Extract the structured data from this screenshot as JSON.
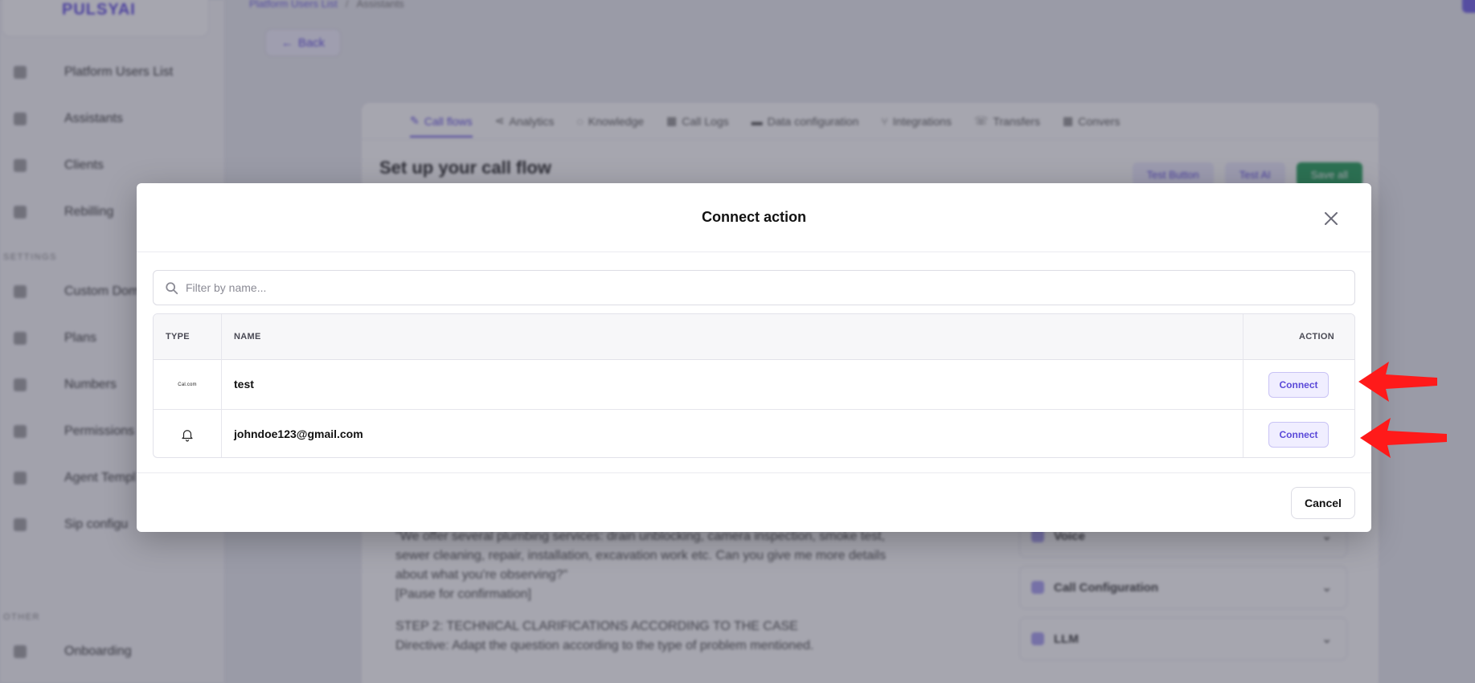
{
  "app": {
    "logo_text": "PULSYAI",
    "breadcrumb": {
      "parent": "Platform Users List",
      "current": "Assistants"
    },
    "back_label": "Back",
    "sidebar": {
      "items": [
        {
          "label": "Platform Users List"
        },
        {
          "label": "Assistants"
        },
        {
          "label": "Clients"
        },
        {
          "label": "Rebilling"
        }
      ],
      "settings_section": "SETTINGS",
      "settings_items": [
        {
          "label": "Custom Dom"
        },
        {
          "label": "Plans"
        },
        {
          "label": "Numbers"
        },
        {
          "label": "Permissions"
        },
        {
          "label": "Agent Templ"
        },
        {
          "label": "Sip configu"
        }
      ],
      "other_section": "OTHER",
      "other_items": [
        {
          "label": "Onboarding"
        }
      ]
    },
    "tabs": [
      {
        "label": "Call flows",
        "icon": "edit-icon",
        "active": true
      },
      {
        "label": "Analytics",
        "icon": "share-icon"
      },
      {
        "label": "Knowledge",
        "icon": "lightbulb-icon"
      },
      {
        "label": "Call Logs",
        "icon": "calendar-icon"
      },
      {
        "label": "Data configuration",
        "icon": "chat-icon"
      },
      {
        "label": "Integrations",
        "icon": "plug-icon"
      },
      {
        "label": "Transfers",
        "icon": "phone-icon"
      },
      {
        "label": "Convers",
        "icon": "calendar-icon"
      }
    ],
    "page_title": "Set up your call flow",
    "actions": {
      "test_button": "Test Button",
      "test_ai": "Test AI",
      "save_all": "Save all"
    },
    "script_lines": [
      "\"We offer several plumbing services: drain unblocking, camera inspection, smoke test,",
      "sewer cleaning, repair, installation, excavation work etc. Can you give me more details",
      "about what you're observing?\"",
      "[Pause for confirmation]",
      "STEP 2: TECHNICAL CLARIFICATIONS ACCORDING TO THE CASE",
      "Directive: Adapt the question according to the type of problem mentioned."
    ],
    "accordions": [
      {
        "label": "Voice"
      },
      {
        "label": "Call Configuration"
      },
      {
        "label": "LLM"
      }
    ]
  },
  "modal": {
    "title": "Connect action",
    "filter_placeholder": "Filter by name...",
    "filter_value": "",
    "columns": {
      "type": "TYPE",
      "name": "NAME",
      "action": "ACTION"
    },
    "rows": [
      {
        "type_icon": "calcom-logo",
        "type_text": "Cal.com",
        "name": "test",
        "action": "Connect"
      },
      {
        "type_icon": "bell-icon",
        "name": "johndoe123@gmail.com",
        "action": "Connect"
      }
    ],
    "cancel_label": "Cancel"
  },
  "colors": {
    "accent": "#5b47e0",
    "annotation_arrow": "#ff1a1a",
    "save_green": "#1f9d55"
  }
}
